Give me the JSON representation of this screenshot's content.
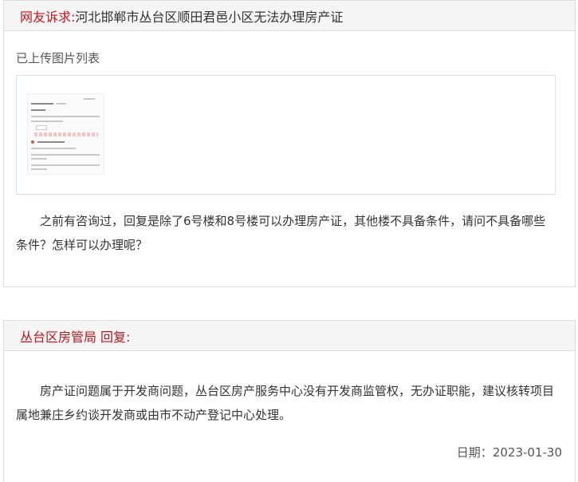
{
  "complaint": {
    "label": "网友诉求:",
    "title": "河北邯郸市丛台区顺田君邑小区无法办理房产证",
    "uploaded_label": "已上传图片列表",
    "body": "之前有咨询过，回复是除了6号楼和8号楼可以办理房产证，其他楼不具备条件，请问不具备哪些条件？怎样可以办理呢？"
  },
  "reply": {
    "department": "丛台区房管局",
    "reply_label": "回复:",
    "body": "房产证问题属于开发商问题，丛台区房产服务中心没有开发商监管权，无办证职能，建议核转项目属地兼庄乡约谈开发商或由市不动产登记中心处理。",
    "date_label": "日期：",
    "date": "2023-01-30"
  }
}
